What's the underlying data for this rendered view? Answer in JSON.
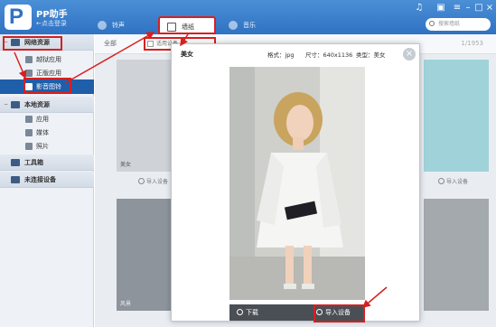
{
  "app": {
    "name": "PP助手",
    "subtitle": "←点击登录",
    "logo_letter": "P"
  },
  "titlebar_icons": [
    "music-note-icon",
    "shirt-icon",
    "menu-icon",
    "minimize-icon",
    "maximize-icon",
    "close-icon"
  ],
  "tabs": [
    {
      "label": "铃声",
      "icon": "bell-icon"
    },
    {
      "label": "墙纸",
      "icon": "picture-icon",
      "active": true
    },
    {
      "label": "音乐",
      "icon": "music-icon"
    }
  ],
  "search": {
    "placeholder": "搜索墙纸"
  },
  "sidebar": {
    "sections": [
      {
        "label": "网络资源",
        "icon": "globe-icon",
        "items": [
          {
            "label": "越狱应用",
            "icon": "app-icon"
          },
          {
            "label": "正版应用",
            "icon": "apple-icon"
          },
          {
            "label": "影音图铃",
            "icon": "media-icon",
            "active": true
          }
        ]
      },
      {
        "label": "本地资源",
        "icon": "monitor-icon",
        "items": [
          {
            "label": "应用",
            "icon": "apps-icon"
          },
          {
            "label": "媒体",
            "icon": "film-icon"
          },
          {
            "label": "照片",
            "icon": "photo-icon"
          }
        ]
      },
      {
        "label": "工具箱",
        "icon": "toolbox-icon",
        "items": []
      },
      {
        "label": "未连接设备",
        "icon": "device-icon",
        "items": []
      }
    ]
  },
  "toolbar": {
    "filter_all": "全部",
    "filter_type": "适用设备",
    "pager": "1/1953"
  },
  "grid": {
    "labels": [
      "美女",
      "风景"
    ],
    "import_label": "导入设备"
  },
  "preview": {
    "title": "美女",
    "format": "格式：jpg",
    "size": "尺寸：640x1136",
    "category": "类型：美女",
    "download_label": "下载",
    "import_label": "导入设备"
  },
  "colors": {
    "titlebar": "#3a7fcf",
    "highlight": "#d62020",
    "active_item": "#1f5ea9"
  }
}
